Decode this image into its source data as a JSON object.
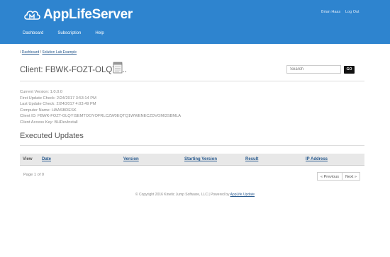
{
  "header": {
    "brand": "AppLifeServer",
    "user": "Brian Haas",
    "logout": "Log Out",
    "nav": [
      "Dashboard",
      "Subscription",
      "Help"
    ]
  },
  "breadcrumb": {
    "items": [
      "Dashboard",
      "Solution Lab Example"
    ]
  },
  "client": {
    "title": "Client: FBWK-FOZT-OLQYI...",
    "info": [
      "Current Version: 1.0.0.0",
      "First Update Check: 2/24/2017 3:53:14 PM",
      "Last Update Check: 2/24/2017 4:03:49 PM",
      "Computer Name: HAASBDESK",
      "Client ID: FBWK-FOZT-OLQYISEMTOOYOFRLCZW0EQTQ1WWENECZDVOMI3SBMLA",
      "Client Access Key: BHDevInstall"
    ]
  },
  "search": {
    "placeholder": "Search",
    "button": "GO"
  },
  "updates": {
    "title": "Executed Updates",
    "columns": [
      "View",
      "Date",
      "Version",
      "Starting Version",
      "Result",
      "IP Address"
    ],
    "page_count": "Page 1 of 0",
    "prev": "« Previous",
    "next": "Next »"
  },
  "footer": {
    "copyright": "© Copyright 2016 Kinetic Jump Software, LLC | Powered by ",
    "link": "AppLife Update"
  }
}
